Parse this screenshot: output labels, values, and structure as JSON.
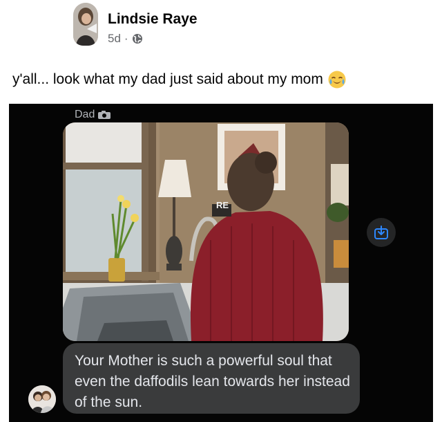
{
  "post": {
    "author": "Lindsie Raye",
    "time": "5d",
    "separator": "·",
    "audience_icon": "globe-icon",
    "caption": "y'all... look what my dad just said about my mom",
    "caption_emoji": "crying-face-emoji"
  },
  "message_screenshot": {
    "sender_label": "Dad",
    "sender_icon": "camera-icon",
    "message": "Your Mother is such a powerful soul that even the daffodils lean towards her instead of the sun.",
    "share_icon": "share-arrow-icon",
    "photo_sign_text": "RE"
  },
  "colors": {
    "accent": "#2d88ff",
    "bubble": "#3a3b3c",
    "meta_text": "#65676b"
  }
}
